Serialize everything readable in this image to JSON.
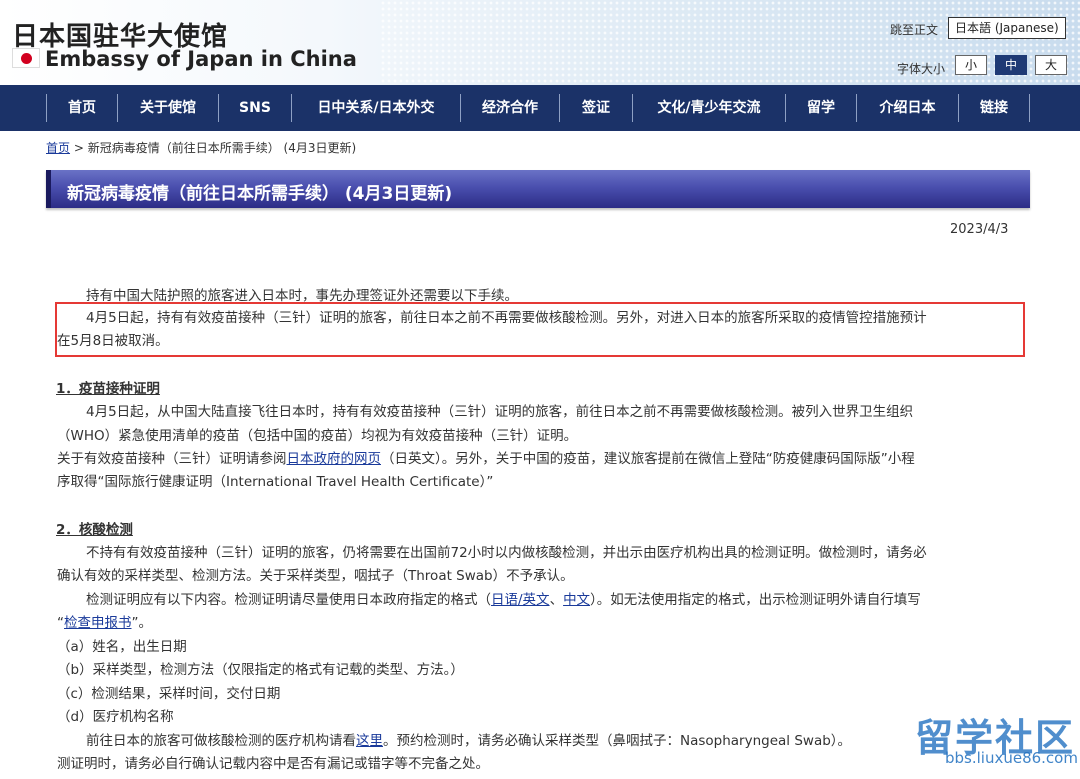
{
  "header": {
    "title_cn": "日本国驻华大使馆",
    "title_en": "Embassy of Japan in China",
    "skip_link": "跳至正文",
    "language_button": "日本語 (Japanese)",
    "font_size_label": "字体大小",
    "font_sizes": [
      "小",
      "中",
      "大"
    ],
    "active_font_size": "中"
  },
  "nav": {
    "items": [
      "首页",
      "关于使馆",
      "SNS",
      "日中关系/日本外交",
      "经济合作",
      "签证",
      "文化/青少年交流",
      "留学",
      "介绍日本",
      "链接"
    ]
  },
  "breadcrumb": {
    "home": "首页",
    "separator": " > ",
    "current": "新冠病毒疫情（前往日本所需手续） (4月3日更新)"
  },
  "page_title": "新冠病毒疫情（前往日本所需手续） (4月3日更新)",
  "date": "2023/4/3",
  "content": {
    "intro": "持有中国大陆护照的旅客进入日本时，事先办理签证外还需要以下手续。",
    "highlight_line1": "4月5日起，持有有效疫苗接种（三针）证明的旅客，前往日本之前不再需要做核酸检测。另外，对进入日本的旅客所采取的疫情管控措施预计",
    "highlight_line2": "在5月8日被取消。",
    "section1_heading": "1．疫苗接种证明",
    "s1_l1": "4月5日起，从中国大陆直接飞往日本时，持有有效疫苗接种（三针）证明的旅客，前往日本之前不再需要做核酸检测。被列入世界卫生组织",
    "s1_l2": "（WHO）紧急使用清单的疫苗（包括中国的疫苗）均视为有效疫苗接种（三针）证明。",
    "s1_l3_before": "关于有效疫苗接种（三针）证明请参阅",
    "s1_l3_link": "日本政府的网页",
    "s1_l3_after": "（日英文）。另外，关于中国的疫苗，建议旅客提前在微信上登陆“防疫健康码国际版”小程",
    "s1_l4": "序取得“国际旅行健康证明（International Travel Health Certificate）”",
    "section2_heading": "2．核酸检测",
    "s2_l1": "不持有有效疫苗接种（三针）证明的旅客，仍将需要在出国前72小时以内做核酸检测，并出示由医疗机构出具的检测证明。做检测时，请务必",
    "s2_l2": "确认有效的采样类型、检测方法。关于采样类型，咽拭子（Throat Swab）不予承认。",
    "s2_l3_before": "检测证明应有以下内容。检测证明请尽量使用日本政府指定的格式（",
    "s2_l3_link1": "日语/英文",
    "s2_l3_mid": "、",
    "s2_l3_link2": "中文",
    "s2_l3_after": "）。如无法使用指定的格式，出示检测证明外请自行填写",
    "s2_l4_open": "“",
    "s2_l4_link": "检查申报书",
    "s2_l4_close": "”。",
    "list_a": "（a）姓名，出生日期",
    "list_b": "（b）采样类型，检测方法（仅限指定的格式有记载的类型、方法。）",
    "list_c": "（c）检测结果，采样时间，交付日期",
    "list_d": "（d）医疗机构名称",
    "s2_l9_before": "前往日本的旅客可做核酸检测的医疗机构请看",
    "s2_l9_link": "这里",
    "s2_l9_after": "。预约检测时，请务必确认采样类型（鼻咽拭子：Nasopharyngeal Swab）。",
    "s2_l10": "测证明时，请务必自行确认记载内容中是否有漏记或错字等不完备之处。"
  },
  "watermark": {
    "text": "留学社区",
    "url": "bbs.liuxue86.com"
  }
}
